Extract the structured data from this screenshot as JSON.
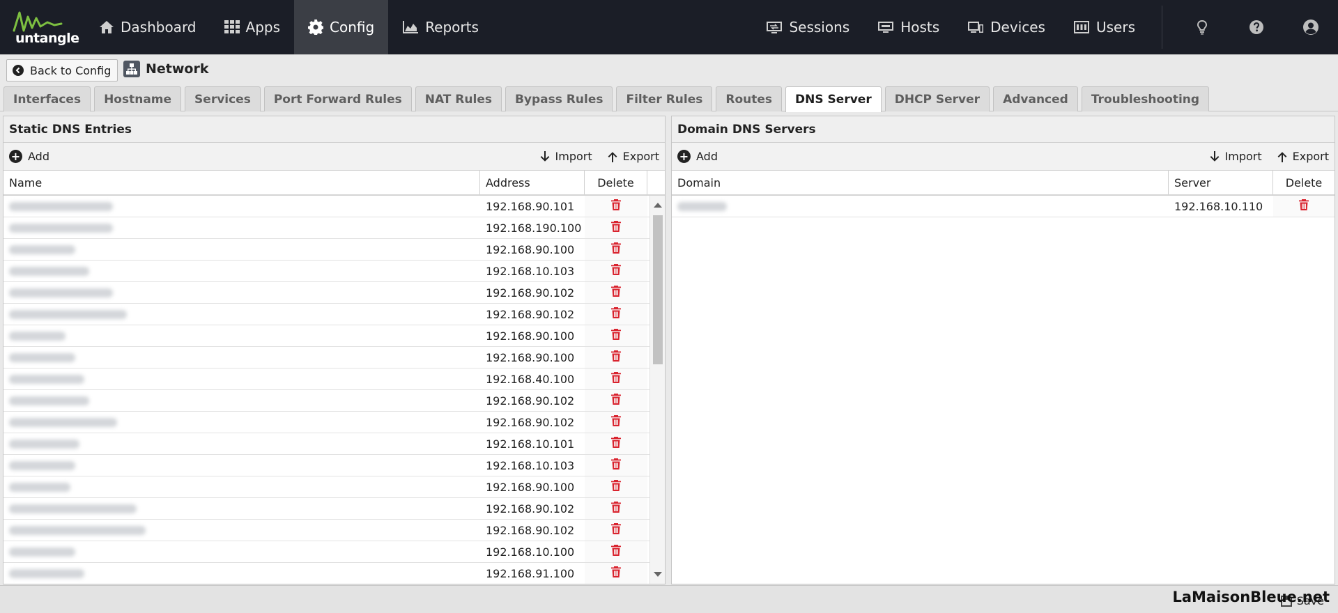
{
  "brand": {
    "name": "untangle"
  },
  "nav": {
    "left": [
      {
        "label": "Dashboard",
        "icon": "home-icon"
      },
      {
        "label": "Apps",
        "icon": "grid-icon"
      },
      {
        "label": "Config",
        "icon": "gear-icon",
        "active": true
      },
      {
        "label": "Reports",
        "icon": "area-chart-icon"
      }
    ],
    "right": [
      {
        "label": "Sessions",
        "icon": "sessions-icon"
      },
      {
        "label": "Hosts",
        "icon": "hosts-icon"
      },
      {
        "label": "Devices",
        "icon": "devices-icon"
      },
      {
        "label": "Users",
        "icon": "users-icon"
      }
    ]
  },
  "subheader": {
    "back_label": "Back to Config",
    "title": "Network"
  },
  "tabs": [
    "Interfaces",
    "Hostname",
    "Services",
    "Port Forward Rules",
    "NAT Rules",
    "Bypass Rules",
    "Filter Rules",
    "Routes",
    "DNS Server",
    "DHCP Server",
    "Advanced",
    "Troubleshooting"
  ],
  "active_tab": "DNS Server",
  "static_dns": {
    "title": "Static DNS Entries",
    "add_label": "Add",
    "import_label": "Import",
    "export_label": "Export",
    "columns": {
      "name": "Name",
      "address": "Address",
      "delete": "Delete"
    },
    "rows": [
      {
        "address": "192.168.90.101",
        "name_blur": 0.22
      },
      {
        "address": "192.168.190.100",
        "name_blur": 0.22
      },
      {
        "address": "192.168.90.100",
        "name_blur": 0.14
      },
      {
        "address": "192.168.10.103",
        "name_blur": 0.17
      },
      {
        "address": "192.168.90.102",
        "name_blur": 0.22
      },
      {
        "address": "192.168.90.102",
        "name_blur": 0.25
      },
      {
        "address": "192.168.90.100",
        "name_blur": 0.12
      },
      {
        "address": "192.168.90.100",
        "name_blur": 0.14
      },
      {
        "address": "192.168.40.100",
        "name_blur": 0.16
      },
      {
        "address": "192.168.90.102",
        "name_blur": 0.17
      },
      {
        "address": "192.168.90.102",
        "name_blur": 0.23
      },
      {
        "address": "192.168.10.101",
        "name_blur": 0.15
      },
      {
        "address": "192.168.10.103",
        "name_blur": 0.14
      },
      {
        "address": "192.168.90.100",
        "name_blur": 0.13
      },
      {
        "address": "192.168.90.102",
        "name_blur": 0.27
      },
      {
        "address": "192.168.90.102",
        "name_blur": 0.29
      },
      {
        "address": "192.168.10.100",
        "name_blur": 0.14
      },
      {
        "address": "192.168.91.100",
        "name_blur": 0.16
      }
    ]
  },
  "domain_dns": {
    "title": "Domain DNS Servers",
    "add_label": "Add",
    "import_label": "Import",
    "export_label": "Export",
    "columns": {
      "domain": "Domain",
      "server": "Server",
      "delete": "Delete"
    },
    "rows": [
      {
        "server": "192.168.10.110",
        "domain_blur": 0.1
      }
    ]
  },
  "footer": {
    "save_label": "Save",
    "watermark": "LaMaisonBleue.net"
  },
  "colors": {
    "topbar": "#1b1e27",
    "active_nav": "#3b3e45",
    "delete_icon": "#d9232e",
    "logo_green": "#7dbf41"
  }
}
